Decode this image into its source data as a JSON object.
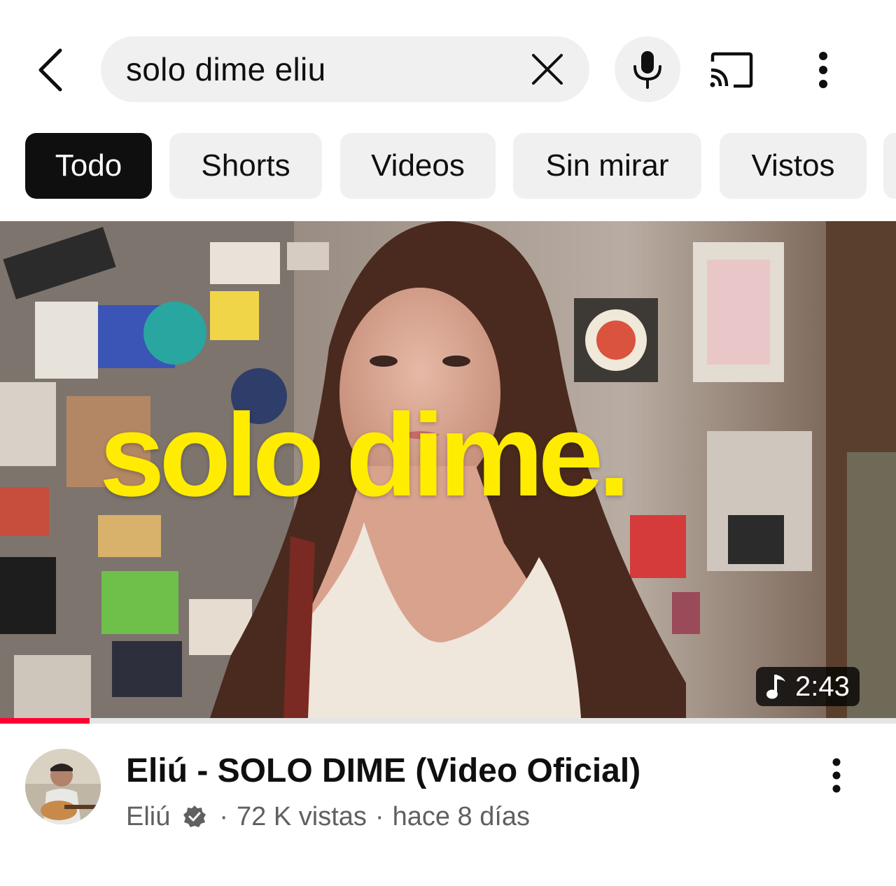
{
  "search": {
    "query": "solo dime eliu"
  },
  "icons": {
    "back": "back-arrow-icon",
    "clear": "close-icon",
    "mic": "microphone-icon",
    "cast": "cast-icon",
    "more": "more-vert-icon",
    "music": "music-note-icon",
    "verified": "verified-badge-icon"
  },
  "chips": [
    {
      "label": "Todo",
      "active": true
    },
    {
      "label": "Shorts",
      "active": false
    },
    {
      "label": "Videos",
      "active": false
    },
    {
      "label": "Sin mirar",
      "active": false
    },
    {
      "label": "Vistos",
      "active": false
    }
  ],
  "video": {
    "thumbnail_text": "solo dime.",
    "duration": "2:43",
    "watched_fraction": 0.1,
    "title": "Eliú - SOLO DIME (Video Oficial)",
    "channel": "Eliú",
    "views": "72 K vistas",
    "age": "hace 8 días",
    "separator": "·"
  },
  "colors": {
    "chip_bg": "#f0f0f0",
    "chip_active_bg": "#0f0f0f",
    "progress": "#ff0033",
    "thumbnail_text": "#ffec00",
    "meta_text": "#606060"
  }
}
